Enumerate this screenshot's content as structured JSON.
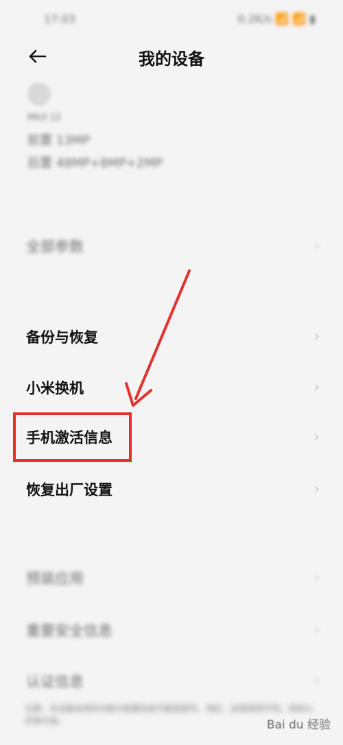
{
  "status_bar": {
    "left_text": "17:03",
    "right_text": "0.2K/s 📶 📶 ▮"
  },
  "header": {
    "title": "我的设备"
  },
  "device_info": {
    "small_label": "MIUI 12",
    "spec_line_1": "前置 13MP",
    "spec_line_2": "后置 48MP+8MP+2MP"
  },
  "list": {
    "all_params": "全部参数",
    "backup_restore": "备份与恢复",
    "mi_mover": "小米换机",
    "activation_info": "手机激活信息",
    "factory_reset": "恢复出厂设置",
    "preinstalled_apps": "预装应用",
    "safety_info": "重要安全信息",
    "certification": "认证信息"
  },
  "footer": {
    "text": "注意：本设备支持的功能与配置信息可能因型号、地区、运营商而不同，具体以实物为准。"
  },
  "watermark": {
    "text": "Bai du 经验"
  },
  "colors": {
    "highlight": "#e3322b",
    "background": "#f4f4f4"
  }
}
